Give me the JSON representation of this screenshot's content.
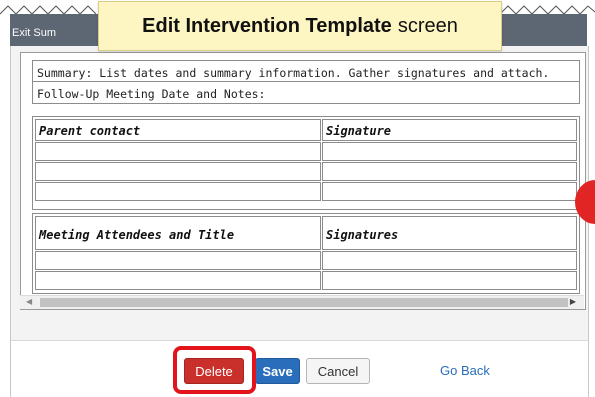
{
  "callout": {
    "bold": "Edit Intervention Template",
    "rest": "screen"
  },
  "window": {
    "title": "Exit Sum"
  },
  "editor": {
    "summary_line": "Summary: List dates and summary information. Gather signatures and attach.",
    "followup_line": "Follow-Up Meeting Date and Notes:",
    "table1": {
      "headers": [
        "Parent contact",
        "Signature"
      ],
      "empty_rows": 3
    },
    "table2": {
      "headers": [
        "Meeting Attendees and Title",
        "Signatures"
      ],
      "empty_rows": 2
    }
  },
  "footer": {
    "delete_label": "Delete",
    "save_label": "Save",
    "cancel_label": "Cancel",
    "go_back_label": "Go Back"
  },
  "colors": {
    "delete": "#c9302c",
    "save": "#2a6ebb",
    "highlight": "#e2131b",
    "callout": "#fdf5c2",
    "titlebar": "#5d6673"
  },
  "icons": {
    "scroll_left": "arrow-left-icon",
    "scroll_right": "arrow-right-icon"
  }
}
